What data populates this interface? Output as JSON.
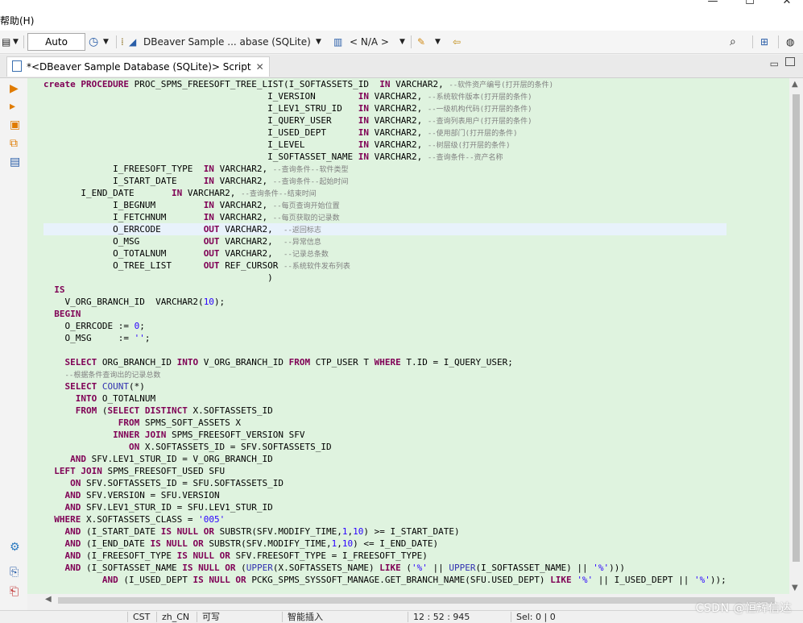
{
  "menu": {
    "help": "帮助(H)"
  },
  "window_controls": {
    "minimize": "—",
    "maximize": "☐",
    "close": "✕"
  },
  "toolbar": {
    "commit_mode": "Auto",
    "datasource": "DBeaver Sample ... abase (SQLite)",
    "schema": "< N/A >"
  },
  "editor": {
    "tab_title": "*<DBeaver Sample Database (SQLite)> Script",
    "tab_close": "✕",
    "lines": [
      [
        [
          "kw",
          "create "
        ],
        [
          "kw",
          "PROCEDURE "
        ],
        [
          "",
          "PROC_SPMS_FREESOFT_TREE_LIST(I_SOFTASSETS_ID  "
        ],
        [
          "kw",
          "IN "
        ],
        [
          "",
          "VARCHAR2, "
        ],
        [
          "cm",
          "--软件资产编号(打开层的条件)"
        ]
      ],
      [
        [
          "",
          "                                          I_VERSION        "
        ],
        [
          "kw",
          "IN "
        ],
        [
          "",
          "VARCHAR2, "
        ],
        [
          "cm",
          "--系统软件版本(打开层的条件)"
        ]
      ],
      [
        [
          "",
          "                                          I_LEV1_STRU_ID   "
        ],
        [
          "kw",
          "IN "
        ],
        [
          "",
          "VARCHAR2, "
        ],
        [
          "cm",
          "--一级机构代码(打开层的条件)"
        ]
      ],
      [
        [
          "",
          "                                          I_QUERY_USER     "
        ],
        [
          "kw",
          "IN "
        ],
        [
          "",
          "VARCHAR2, "
        ],
        [
          "cm",
          "--查询列表用户(打开层的条件)"
        ]
      ],
      [
        [
          "",
          "                                          I_USED_DEPT      "
        ],
        [
          "kw",
          "IN "
        ],
        [
          "",
          "VARCHAR2, "
        ],
        [
          "cm",
          "--使用部门(打开层的条件)"
        ]
      ],
      [
        [
          "",
          "                                          I_LEVEL          "
        ],
        [
          "kw",
          "IN "
        ],
        [
          "",
          "VARCHAR2, "
        ],
        [
          "cm",
          "--树层级(打开层的条件)"
        ]
      ],
      [
        [
          "",
          "                                          I_SOFTASSET_NAME "
        ],
        [
          "kw",
          "IN "
        ],
        [
          "",
          "VARCHAR2, "
        ],
        [
          "cm",
          "--查询条件--资产名称"
        ]
      ],
      [
        [
          "",
          "             I_FREESOFT_TYPE  "
        ],
        [
          "kw",
          "IN "
        ],
        [
          "",
          "VARCHAR2, "
        ],
        [
          "cm",
          "--查询条件--软件类型"
        ]
      ],
      [
        [
          "",
          "             I_START_DATE     "
        ],
        [
          "kw",
          "IN "
        ],
        [
          "",
          "VARCHAR2, "
        ],
        [
          "cm",
          "--查询条件--起始时间"
        ]
      ],
      [
        [
          "",
          "       I_END_DATE       "
        ],
        [
          "kw",
          "IN "
        ],
        [
          "",
          "VARCHAR2, "
        ],
        [
          "cm",
          "--查询条件--结束时间"
        ]
      ],
      [
        [
          "",
          "             I_BEGNUM         "
        ],
        [
          "kw",
          "IN "
        ],
        [
          "",
          "VARCHAR2, "
        ],
        [
          "cm",
          "--每页查询开始位置"
        ]
      ],
      [
        [
          "",
          "             I_FETCHNUM       "
        ],
        [
          "kw",
          "IN "
        ],
        [
          "",
          "VARCHAR2, "
        ],
        [
          "cm",
          "--每页获取的记录数"
        ]
      ],
      [
        [
          "",
          "             O_ERRCODE        "
        ],
        [
          "kw",
          "OUT "
        ],
        [
          "",
          "VARCHAR2,  "
        ],
        [
          "cm",
          "--返回标志"
        ]
      ],
      [
        [
          "",
          "             O_MSG            "
        ],
        [
          "kw",
          "OUT "
        ],
        [
          "",
          "VARCHAR2,  "
        ],
        [
          "cm",
          "--异常信息"
        ]
      ],
      [
        [
          "",
          "             O_TOTALNUM       "
        ],
        [
          "kw",
          "OUT "
        ],
        [
          "",
          "VARCHAR2,  "
        ],
        [
          "cm",
          "--记录总条数"
        ]
      ],
      [
        [
          "",
          "             O_TREE_LIST      "
        ],
        [
          "kw",
          "OUT "
        ],
        [
          "",
          "REF_CURSOR "
        ],
        [
          "cm",
          "--系统软件发布列表"
        ]
      ],
      [
        [
          "",
          "                                          )"
        ]
      ],
      [
        [
          "",
          "  "
        ],
        [
          "kw",
          "IS"
        ]
      ],
      [
        [
          "",
          "    V_ORG_BRANCH_ID  VARCHAR2("
        ],
        [
          "num",
          "10"
        ],
        [
          "",
          ");"
        ]
      ],
      [
        [
          "",
          "  "
        ],
        [
          "kw",
          "BEGIN"
        ]
      ],
      [
        [
          "",
          "    O_ERRCODE := "
        ],
        [
          "num",
          "0"
        ],
        [
          "",
          ";"
        ]
      ],
      [
        [
          "",
          "    O_MSG     := "
        ],
        [
          "str",
          "''"
        ],
        [
          "",
          ";"
        ]
      ],
      [
        [
          "",
          ""
        ]
      ],
      [
        [
          "",
          "    "
        ],
        [
          "kw",
          "SELECT "
        ],
        [
          "",
          "ORG_BRANCH_ID "
        ],
        [
          "kw",
          "INTO "
        ],
        [
          "",
          "V_ORG_BRANCH_ID "
        ],
        [
          "kw",
          "FROM "
        ],
        [
          "",
          "CTP_USER T "
        ],
        [
          "kw",
          "WHERE "
        ],
        [
          "",
          "T.ID = I_QUERY_USER;"
        ]
      ],
      [
        [
          "",
          "    "
        ],
        [
          "cm",
          "--根据条件查询出的记录总数"
        ]
      ],
      [
        [
          "",
          "    "
        ],
        [
          "kw",
          "SELECT "
        ],
        [
          "fn",
          "COUNT"
        ],
        [
          "",
          "(*)"
        ]
      ],
      [
        [
          "",
          "      "
        ],
        [
          "kw",
          "INTO "
        ],
        [
          "",
          "O_TOTALNUM"
        ]
      ],
      [
        [
          "",
          "      "
        ],
        [
          "kw",
          "FROM "
        ],
        [
          "",
          "("
        ],
        [
          "kw",
          "SELECT DISTINCT "
        ],
        [
          "",
          "X.SOFTASSETS_ID"
        ]
      ],
      [
        [
          "",
          "              "
        ],
        [
          "kw",
          "FROM "
        ],
        [
          "",
          "SPMS_SOFT_ASSETS X"
        ]
      ],
      [
        [
          "",
          "             "
        ],
        [
          "kw",
          "INNER JOIN "
        ],
        [
          "",
          "SPMS_FREESOFT_VERSION SFV"
        ]
      ],
      [
        [
          "",
          "                "
        ],
        [
          "kw",
          "ON "
        ],
        [
          "",
          "X.SOFTASSETS_ID = SFV.SOFTASSETS_ID"
        ]
      ],
      [
        [
          "",
          "     "
        ],
        [
          "kw",
          "AND "
        ],
        [
          "",
          "SFV.LEV1_STUR_ID = V_ORG_BRANCH_ID"
        ]
      ],
      [
        [
          "",
          "  "
        ],
        [
          "kw",
          "LEFT JOIN "
        ],
        [
          "",
          "SPMS_FREESOFT_USED SFU"
        ]
      ],
      [
        [
          "",
          "     "
        ],
        [
          "kw",
          "ON "
        ],
        [
          "",
          "SFV.SOFTASSETS_ID = SFU.SOFTASSETS_ID"
        ]
      ],
      [
        [
          "",
          "    "
        ],
        [
          "kw",
          "AND "
        ],
        [
          "",
          "SFV.VERSION = SFU.VERSION"
        ]
      ],
      [
        [
          "",
          "    "
        ],
        [
          "kw",
          "AND "
        ],
        [
          "",
          "SFV.LEV1_STUR_ID = SFU.LEV1_STUR_ID"
        ]
      ],
      [
        [
          "",
          "  "
        ],
        [
          "kw",
          "WHERE "
        ],
        [
          "",
          "X.SOFTASSETS_CLASS = "
        ],
        [
          "str",
          "'005'"
        ]
      ],
      [
        [
          "",
          "    "
        ],
        [
          "kw",
          "AND "
        ],
        [
          "",
          "(I_START_DATE "
        ],
        [
          "kw",
          "IS NULL OR "
        ],
        [
          "",
          "SUBSTR(SFV.MODIFY_TIME,"
        ],
        [
          "num",
          "1"
        ],
        [
          "",
          ","
        ],
        [
          "num",
          "10"
        ],
        [
          "",
          ") >= I_START_DATE)"
        ]
      ],
      [
        [
          "",
          "    "
        ],
        [
          "kw",
          "AND "
        ],
        [
          "",
          "(I_END_DATE "
        ],
        [
          "kw",
          "IS NULL OR "
        ],
        [
          "",
          "SUBSTR(SFV.MODIFY_TIME,"
        ],
        [
          "num",
          "1"
        ],
        [
          "",
          ","
        ],
        [
          "num",
          "10"
        ],
        [
          "",
          ") <= I_END_DATE)"
        ]
      ],
      [
        [
          "",
          "    "
        ],
        [
          "kw",
          "AND "
        ],
        [
          "",
          "(I_FREESOFT_TYPE "
        ],
        [
          "kw",
          "IS NULL OR "
        ],
        [
          "",
          "SFV.FREESOFT_TYPE = I_FREESOFT_TYPE)"
        ]
      ],
      [
        [
          "",
          "    "
        ],
        [
          "kw",
          "AND "
        ],
        [
          "",
          "(I_SOFTASSET_NAME "
        ],
        [
          "kw",
          "IS NULL OR "
        ],
        [
          "",
          "("
        ],
        [
          "fn",
          "UPPER"
        ],
        [
          "",
          "(X.SOFTASSETS_NAME) "
        ],
        [
          "kw",
          "LIKE "
        ],
        [
          "",
          "("
        ],
        [
          "str",
          "'%'"
        ],
        [
          "",
          " || "
        ],
        [
          "fn",
          "UPPER"
        ],
        [
          "",
          "(I_SOFTASSET_NAME) || "
        ],
        [
          "str",
          "'%'"
        ],
        [
          "",
          ")))"
        ]
      ],
      [
        [
          "",
          "           "
        ],
        [
          "kw",
          "AND "
        ],
        [
          "",
          "(I_USED_DEPT "
        ],
        [
          "kw",
          "IS NULL OR "
        ],
        [
          "",
          "PCKG_SPMS_SYSSOFT_MANAGE.GET_BRANCH_NAME(SFU.USED_DEPT) "
        ],
        [
          "kw",
          "LIKE "
        ],
        [
          "str",
          "'%'"
        ],
        [
          "",
          " || I_USED_DEPT || "
        ],
        [
          "str",
          "'%'"
        ],
        [
          "",
          "));"
        ]
      ]
    ],
    "highlight_line": 12
  },
  "statusbar": {
    "timezone": "CST",
    "locale": "zh_CN",
    "mode": "可写",
    "insert_mode": "智能插入",
    "position": "12 : 52 : 945",
    "selection": "Sel: 0 | 0"
  },
  "watermark": "CSDN @恒辉信达"
}
